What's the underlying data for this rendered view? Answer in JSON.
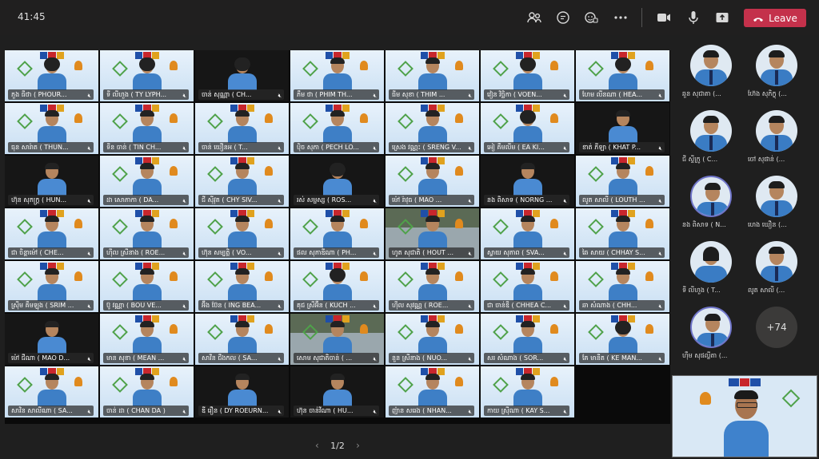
{
  "toolbar": {
    "timer": "41:45",
    "leave_label": "Leave",
    "icons": [
      "people-icon",
      "chat-icon",
      "reactions-icon",
      "more-icon",
      "camera-icon",
      "mic-icon",
      "share-icon",
      "phone-icon"
    ]
  },
  "grid": {
    "rows": [
      [
        "ភួង ធីថា ( PHOUR...",
        "ទី លីហួង ( TY LYPH...",
        "ចាន់ សុណ្ណា ( CH...",
        "ភឹម ថា ( PHIM TH...",
        "ធីម សុខា ( THIM ...",
        "វៀន វិច្ឆិកា ( VOEN...",
        "ហែម លីនណា ( HEA..."
      ],
      [
        "ធុន សារ៉ាត ( THUN...",
        "ទីន ចាន់ ( TIN CH...",
        "ចាន់ យឿនអ ( T...",
        "ប៉ិច សុភា ( PECH LO...",
        "ស្រេង វណ្ណះ ( SRENG V...",
        "អៀ គឹមលីម ( EA KI...",
        "ខាត់ ភីឡា ( KHAT P..."
      ],
      [
        "ហ៊ុន សុភក្ត្រ ( HUN...",
        "ដា សោភាកា ( DA...",
        "ជី ស៊ីវុត ( CHY SIV...",
        "រស់ សម្ផស្ស ( ROS...",
        "ម៉ៅ រ៉ាវុធ ( MAO ...",
        "នង ពិសាទ ( NORNG ...",
        "លូត សាលី ( LOUTH ..."
      ],
      [
        "ជា ចិន្តាម៉ៅ ( CHE...",
        "ហ៊ីល ស្រីនាង ( ROE...",
        "ហ៊ុន សម្បត្តិ ( VO...",
        "ផល សុភាឌីណា ( PH...",
        "ហូត សុជាតិ ( HOUT ...",
        "ស្វាយ សុភាព ( SVA...",
        "ឆៃ សាយ ( CHHAY S..."
      ],
      [
        "ស្រ៊ីម គឹមឡុង ( SRIM ...",
        "ប៊ូ វណ្ណា ( BOU VE...",
        "អ៊ឹង ប៊ែន ( ING BEA...",
        "គុជ ស្រីអ៊ីន ( KUCH ...",
        "ហ៊ីល សុវណ្ណ ( ROE...",
        "ជា ចាន់ឌី ( CHHEA C...",
        "ឆា សំណាង ( CHH..."
      ],
      [
        "ម៉ៅ ជីណា ( MAO D...",
        "មាន សុខា ( MEAN ...",
        "សាវីន ជឹងកល ( SA...",
        "សោម សុជាតិចាន់ ( ...",
        "នួន ស្រីនាង ( NUO...",
        "សរ សំណាង ( SOR...",
        "គែ មានីត ( KE MAN..."
      ],
      [
        "សាវិន សាលីណា ( SA...",
        "ចាន់ ដា ( CHAN DA )",
        "ឌី រឿន ( DY ROEURN...",
        "ហ៊ុន ចាន់វីណា ( HU...",
        "ញ៉ាន សរេង ( NHAN...",
        "កាយ ស្រ៊ីណា ( KAY S...",
        ""
      ]
    ]
  },
  "pager": {
    "label": "1/2",
    "prev": "‹",
    "next": "›"
  },
  "sidebar": {
    "participants": [
      "ឆួន សុជាតា (...",
      "ហ៊ែង សុភិក្ខុ (...",
      "ជី ស្ទីក្រូ ( C...",
      "ចៅ សុផាន់ (...",
      "នង ពិសាទ ( N...",
      "ហេង ឃឿន (...",
      "ទី លីហួង ( T...",
      "លូត សាលី (...",
      "ហ៊ឹម សុផល្លីតា (..."
    ],
    "more_count": "+74"
  }
}
